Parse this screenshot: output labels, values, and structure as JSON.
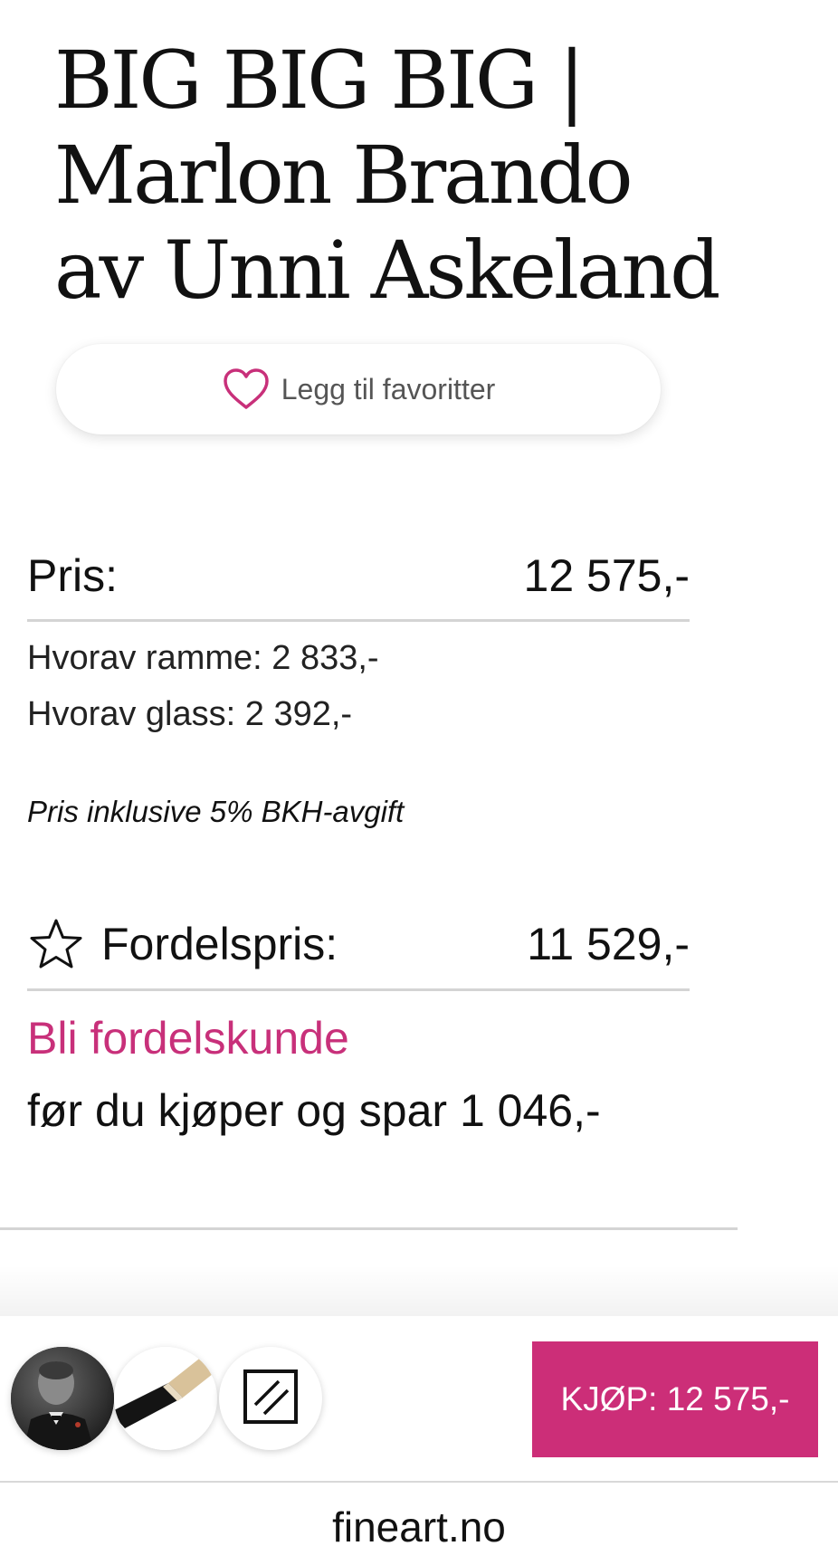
{
  "product": {
    "title": "BIG BIG BIG | Marlon Brando av Unni Askeland"
  },
  "favorite": {
    "label": "Legg til favoritter",
    "icon": "heart-outline-icon"
  },
  "price": {
    "label": "Pris:",
    "value": "12 575,-",
    "frame_line": "Hvorav ramme: 2 833,-",
    "glass_line": "Hvorav glass: 2 392,-",
    "vat_note": "Pris inklusive 5% BKH-avgift"
  },
  "member_price": {
    "icon": "star-outline-icon",
    "label": "Fordelspris:",
    "value": "11 529,-",
    "join_link": "Bli fordelskunde",
    "savings_text": "før du kjøper og spar 1 046,-"
  },
  "bottom_bar": {
    "thumbnails": [
      {
        "name": "artwork-thumbnail"
      },
      {
        "name": "frame-thumbnail"
      },
      {
        "name": "glass-thumbnail",
        "icon": "glass-icon"
      }
    ],
    "buy_label": "KJØP:  12 575,-"
  },
  "browser": {
    "url": "fineart.no"
  },
  "colors": {
    "accent": "#cc2e78",
    "link": "#c8307a",
    "divider": "#d4d4d4",
    "text": "#111111"
  }
}
